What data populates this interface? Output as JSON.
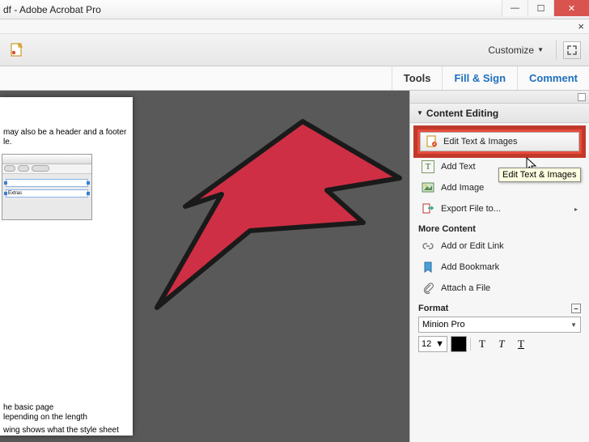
{
  "titlebar": {
    "title": "df - Adobe Acrobat Pro"
  },
  "toolbar": {
    "customize_label": "Customize"
  },
  "tabs": {
    "tools": "Tools",
    "fill_sign": "Fill & Sign",
    "comment": "Comment"
  },
  "document": {
    "line1": "may also be a header and a footer",
    "line2": "le.",
    "line3a": "he basic page",
    "line3b": "lepending on the length",
    "line4": "wing shows what the style sheet",
    "mini_selected": "Extras"
  },
  "sidebar": {
    "section_title": "Content Editing",
    "edit_text_images": "Edit Text & Images",
    "add_text": "Add Text",
    "add_image": "Add Image",
    "export_file": "Export File to...",
    "more_content": "More Content",
    "add_edit_link": "Add or Edit Link",
    "add_bookmark": "Add Bookmark",
    "attach_file": "Attach a File",
    "format": "Format",
    "font": "Minion Pro",
    "font_size": "12"
  },
  "tooltip": {
    "edit_text_images": "Edit Text & Images"
  }
}
